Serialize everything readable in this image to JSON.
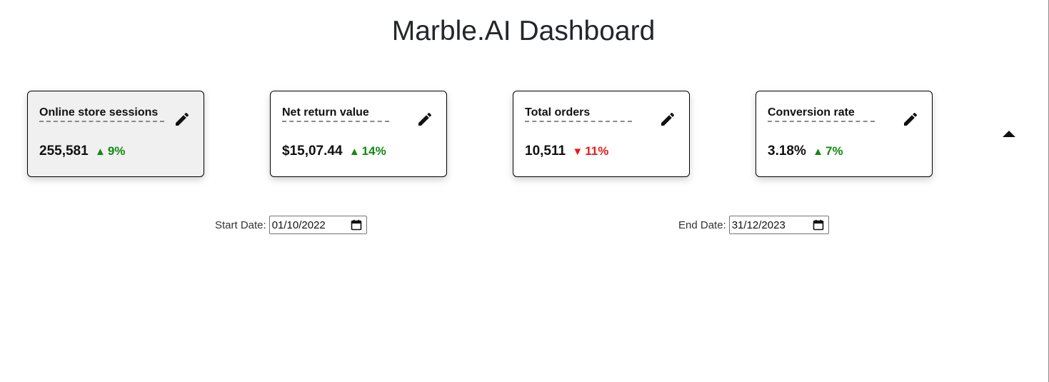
{
  "header": {
    "title": "Marble.AI Dashboard"
  },
  "cards": [
    {
      "title": "Online store sessions",
      "value": "255,581",
      "delta": "9%",
      "direction": "up",
      "selected": true
    },
    {
      "title": "Net return value",
      "value": "$15,07.44",
      "delta": "14%",
      "direction": "up",
      "selected": false
    },
    {
      "title": "Total orders",
      "value": "10,511",
      "delta": "11%",
      "direction": "down",
      "selected": false
    },
    {
      "title": "Conversion rate",
      "value": "3.18%",
      "delta": "7%",
      "direction": "up",
      "selected": false
    }
  ],
  "icons": {
    "edit": "pencil-icon",
    "collapse": "caret-up-icon",
    "calendar": "calendar-icon",
    "delta_up": "▲",
    "delta_down": "▼"
  },
  "colors": {
    "up": "#118a11",
    "down": "#e51c1c"
  },
  "date_range": {
    "start_label": "Start Date:",
    "start_value": "01/10/2022",
    "end_label": "End Date:",
    "end_value": "31/12/2023"
  }
}
